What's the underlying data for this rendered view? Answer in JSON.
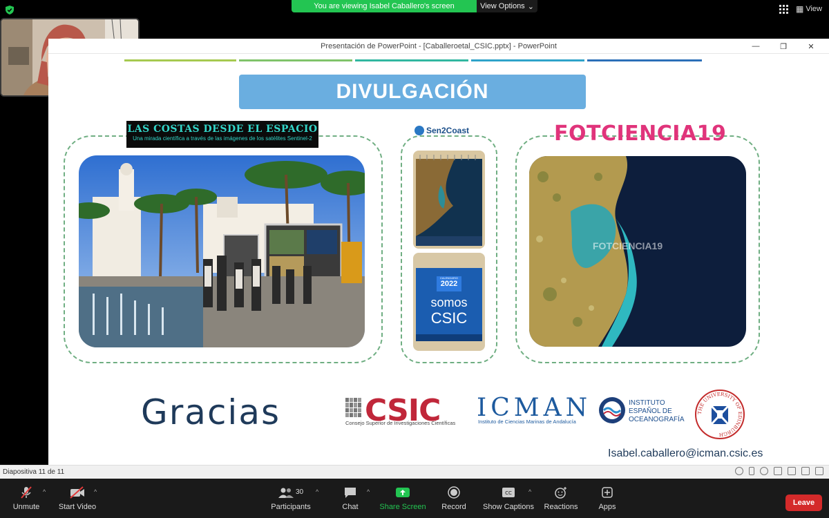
{
  "zoom": {
    "banner_text": "You are viewing Isabel Caballero's screen",
    "view_options_label": "View Options",
    "view_label": "View",
    "toolbar": {
      "unmute": "Unmute",
      "start_video": "Start Video",
      "participants": "Participants",
      "participants_count": "30",
      "chat": "Chat",
      "share_screen": "Share Screen",
      "record": "Record",
      "show_captions": "Show Captions",
      "reactions": "Reactions",
      "apps": "Apps",
      "leave": "Leave"
    }
  },
  "powerpoint": {
    "window_title": "Presentación de PowerPoint - [Caballeroetal_CSIC.pptx] - PowerPoint",
    "status_text": "Diapositiva 11 de 11"
  },
  "slide": {
    "heading": "DIVULGACIÓN",
    "costas_title": "LAS COSTAS DESDE EL ESPACIO",
    "costas_subtitle": "Una mirada científica a través de las imágenes de los satélites Sentinel-2",
    "sen2coast_label": "Sen2Coast",
    "calendar_year": "2022",
    "calendar_text_line1": "somos",
    "calendar_text_line2": "CSIC",
    "calendar_month_label": "CALENDARIO",
    "fotociencia_title": "FOTCIENCIA19",
    "fotociencia_overlay": "FOTCIENCIA19",
    "gracias": "Gracias",
    "csic_logo": "CSIC",
    "csic_subtitle": "Consejo Superior de Investigaciones Científicas",
    "icman_logo": "ICMAN",
    "icman_subtitle": "Instituto de Ciencias Marinas de Andalucía",
    "ieo_line1": "INSTITUTO",
    "ieo_line2": "ESPAÑOL DE",
    "ieo_line3": "OCEANOGRAFÍA",
    "edinburgh_text": "THE UNIVERSITY OF EDINBURGH",
    "email": "Isabel.caballero@icman.csic.es"
  },
  "colors": {
    "zoom_green": "#23c552",
    "leave_red": "#d42a2a",
    "heading_blue": "#6aaee0",
    "fotociencia_pink": "#e0347b",
    "csic_red": "#c0273a",
    "icman_blue": "#1d5a9e"
  }
}
